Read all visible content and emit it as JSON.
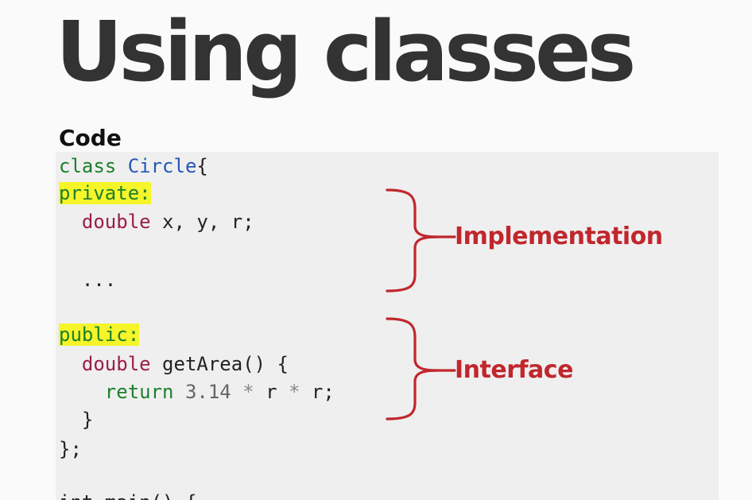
{
  "slide": {
    "title": "Using classes",
    "code_heading": "Code"
  },
  "code": {
    "line1": {
      "kw": "class",
      "name": "Circle",
      "rest": "{"
    },
    "line2": {
      "access": "private:"
    },
    "line3": {
      "indent": "  ",
      "type": "double",
      "rest": " x, y, r;"
    },
    "line4": {
      "text": ""
    },
    "line5": {
      "text": "  ..."
    },
    "line6": {
      "text": ""
    },
    "line7": {
      "access": "public:"
    },
    "line8": {
      "indent": "  ",
      "type": "double",
      "rest": " getArea() {"
    },
    "line9": {
      "indent": "    ",
      "kw": "return",
      "sp1": " ",
      "num": "3.14",
      "sp2": " ",
      "op1": "*",
      "mid": " r ",
      "op2": "*",
      "end": " r;"
    },
    "line10": {
      "text": "  }"
    },
    "line11": {
      "text": "};"
    },
    "line12": {
      "text": ""
    },
    "line13": {
      "text": "int main() {"
    }
  },
  "annotations": {
    "implementation": "Implementation",
    "interface": "Interface"
  },
  "colors": {
    "title": "#333333",
    "annotation": "#c0272d",
    "highlight": "#f5f52a",
    "code_background": "#efefef"
  }
}
